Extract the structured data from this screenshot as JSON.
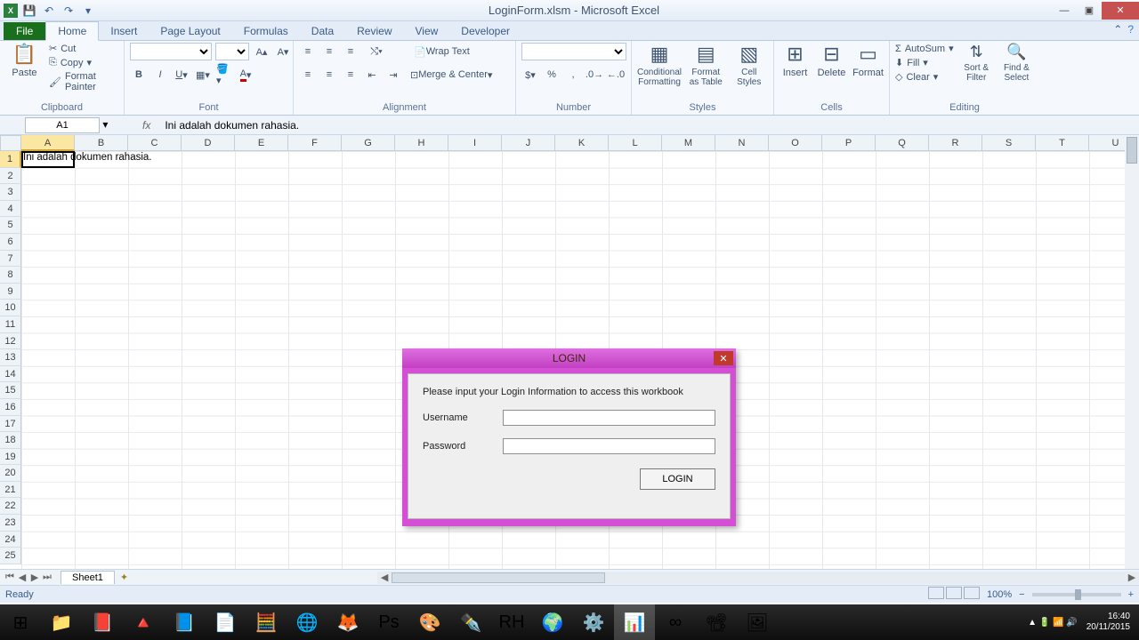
{
  "window": {
    "title": "LoginForm.xlsm - Microsoft Excel"
  },
  "qat": {
    "save": "💾",
    "undo": "↶",
    "redo": "↷"
  },
  "tabs": {
    "file": "File",
    "items": [
      "Home",
      "Insert",
      "Page Layout",
      "Formulas",
      "Data",
      "Review",
      "View",
      "Developer"
    ],
    "active": 0
  },
  "ribbon": {
    "clipboard": {
      "label": "Clipboard",
      "paste": "Paste",
      "cut": "Cut",
      "copy": "Copy",
      "formatpainter": "Format Painter"
    },
    "font": {
      "label": "Font",
      "font": "",
      "size": ""
    },
    "alignment": {
      "label": "Alignment",
      "wrap": "Wrap Text",
      "merge": "Merge & Center"
    },
    "number": {
      "label": "Number",
      "format": ""
    },
    "styles": {
      "label": "Styles",
      "cond": "Conditional\nFormatting",
      "table": "Format\nas Table",
      "cell": "Cell\nStyles"
    },
    "cells": {
      "label": "Cells",
      "insert": "Insert",
      "delete": "Delete",
      "format": "Format"
    },
    "editing": {
      "label": "Editing",
      "autosum": "AutoSum",
      "fill": "Fill",
      "clear": "Clear",
      "sort": "Sort &\nFilter",
      "find": "Find &\nSelect"
    }
  },
  "nameBox": "A1",
  "formula": "Ini adalah dokumen rahasia.",
  "columns": [
    "A",
    "B",
    "C",
    "D",
    "E",
    "F",
    "G",
    "H",
    "I",
    "J",
    "K",
    "L",
    "M",
    "N",
    "O",
    "P",
    "Q",
    "R",
    "S",
    "T",
    "U"
  ],
  "rowCount": 25,
  "cellA1": "Ini adalah dokumen rahasia.",
  "dialog": {
    "title": "LOGIN",
    "instruction": "Please input your Login Information to access this workbook",
    "userLabel": "Username",
    "passLabel": "Password",
    "userValue": "",
    "passValue": "",
    "button": "LOGIN"
  },
  "sheet": {
    "name": "Sheet1"
  },
  "status": {
    "ready": "Ready",
    "zoom": "100%"
  },
  "tray": {
    "time": "16:40",
    "date": "20/11/2015"
  },
  "taskbarApps": [
    "⊞",
    "📁",
    "📕",
    "🔺",
    "📘",
    "📄",
    "🧮",
    "🌐",
    "🦊",
    "Ps",
    "🎨",
    "✒️",
    "RH",
    "🌍",
    "⚙️",
    "📊",
    "∞",
    "📽",
    "🖼"
  ]
}
